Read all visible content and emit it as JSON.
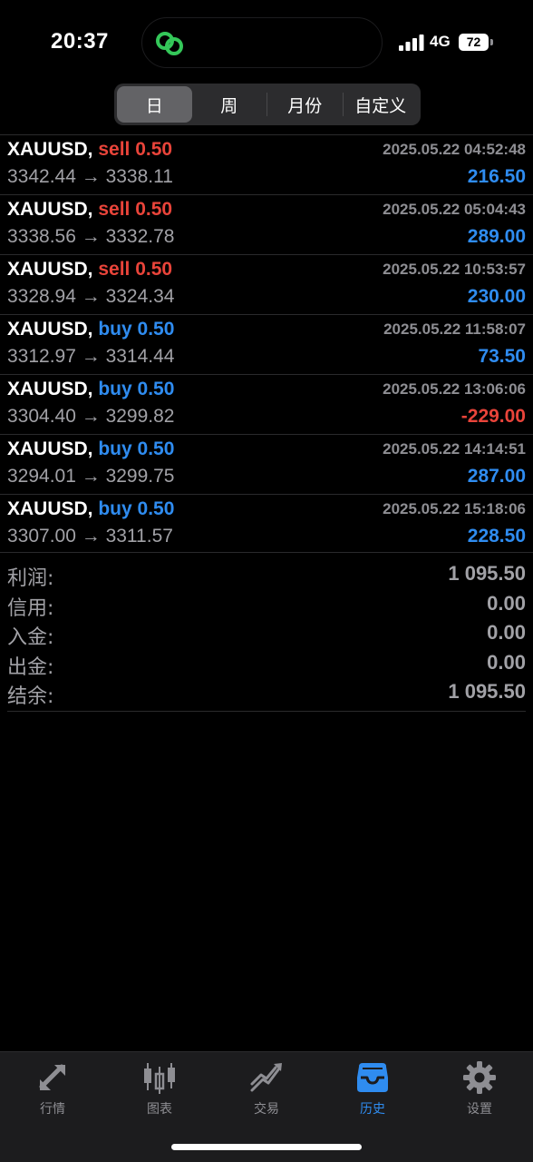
{
  "status_bar": {
    "time": "20:37",
    "network": "4G",
    "battery": "72"
  },
  "period_tabs": [
    {
      "label": "日",
      "active": true
    },
    {
      "label": "周",
      "active": false
    },
    {
      "label": "月份",
      "active": false
    },
    {
      "label": "自定义",
      "active": false
    }
  ],
  "trades": [
    {
      "symbol": "XAUUSD,",
      "side": "sell",
      "volume": "sell 0.50",
      "time": "2025.05.22 04:52:48",
      "prices": "3342.44 → 3338.11",
      "profit": "216.50",
      "positive": true
    },
    {
      "symbol": "XAUUSD,",
      "side": "sell",
      "volume": "sell 0.50",
      "time": "2025.05.22 05:04:43",
      "prices": "3338.56 → 3332.78",
      "profit": "289.00",
      "positive": true
    },
    {
      "symbol": "XAUUSD,",
      "side": "sell",
      "volume": "sell 0.50",
      "time": "2025.05.22 10:53:57",
      "prices": "3328.94 → 3324.34",
      "profit": "230.00",
      "positive": true
    },
    {
      "symbol": "XAUUSD,",
      "side": "buy",
      "volume": "buy 0.50",
      "time": "2025.05.22 11:58:07",
      "prices": "3312.97 → 3314.44",
      "profit": "73.50",
      "positive": true
    },
    {
      "symbol": "XAUUSD,",
      "side": "buy",
      "volume": "buy 0.50",
      "time": "2025.05.22 13:06:06",
      "prices": "3304.40 → 3299.82",
      "profit": "-229.00",
      "positive": false
    },
    {
      "symbol": "XAUUSD,",
      "side": "buy",
      "volume": "buy 0.50",
      "time": "2025.05.22 14:14:51",
      "prices": "3294.01 → 3299.75",
      "profit": "287.00",
      "positive": true
    },
    {
      "symbol": "XAUUSD,",
      "side": "buy",
      "volume": "buy 0.50",
      "time": "2025.05.22 15:18:06",
      "prices": "3307.00 → 3311.57",
      "profit": "228.50",
      "positive": true
    }
  ],
  "summary": [
    {
      "label": "利润:",
      "value": "1 095.50"
    },
    {
      "label": "信用:",
      "value": "0.00"
    },
    {
      "label": "入金:",
      "value": "0.00"
    },
    {
      "label": "出金:",
      "value": "0.00"
    },
    {
      "label": "结余:",
      "value": "1 095.50"
    }
  ],
  "tabbar": [
    {
      "label": "行情",
      "icon": "quotes-icon",
      "active": false
    },
    {
      "label": "图表",
      "icon": "chart-icon",
      "active": false
    },
    {
      "label": "交易",
      "icon": "trade-icon",
      "active": false
    },
    {
      "label": "历史",
      "icon": "history-icon",
      "active": true
    },
    {
      "label": "设置",
      "icon": "settings-icon",
      "active": false
    }
  ],
  "colors": {
    "sell": "#e9443a",
    "buy": "#2f8cf0",
    "profit_positive": "#2f8cf0",
    "profit_negative": "#e9443a",
    "active_tab": "#2f8cf0",
    "island_icon": "#34c759"
  }
}
